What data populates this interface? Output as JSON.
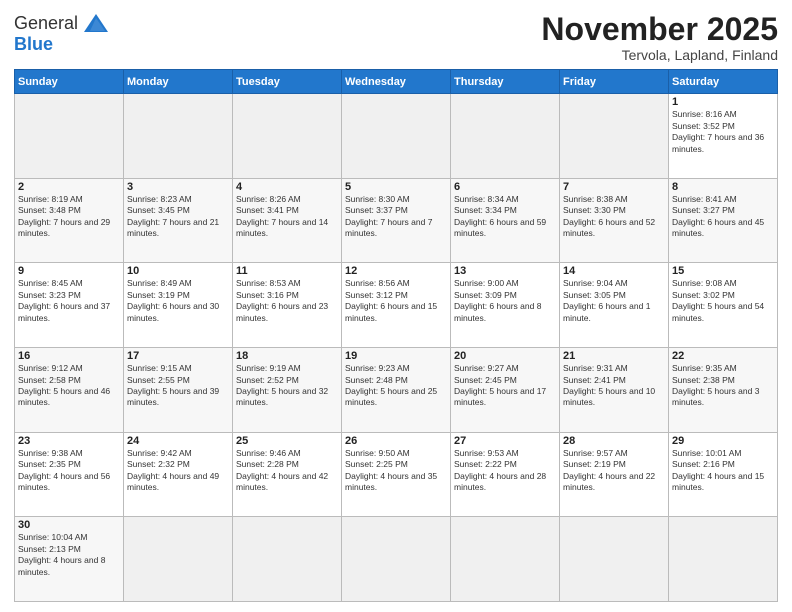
{
  "header": {
    "logo": {
      "general": "General",
      "blue": "Blue"
    },
    "title": "November 2025",
    "subtitle": "Tervola, Lapland, Finland"
  },
  "weekdays": [
    "Sunday",
    "Monday",
    "Tuesday",
    "Wednesday",
    "Thursday",
    "Friday",
    "Saturday"
  ],
  "weeks": [
    [
      {
        "day": null,
        "empty": true
      },
      {
        "day": null,
        "empty": true
      },
      {
        "day": null,
        "empty": true
      },
      {
        "day": null,
        "empty": true
      },
      {
        "day": null,
        "empty": true
      },
      {
        "day": null,
        "empty": true
      },
      {
        "day": "1",
        "sunrise": "8:16 AM",
        "sunset": "3:52 PM",
        "daylight": "7 hours and 36 minutes."
      }
    ],
    [
      {
        "day": "2",
        "sunrise": "8:19 AM",
        "sunset": "3:48 PM",
        "daylight": "7 hours and 29 minutes."
      },
      {
        "day": "3",
        "sunrise": "8:23 AM",
        "sunset": "3:45 PM",
        "daylight": "7 hours and 21 minutes."
      },
      {
        "day": "4",
        "sunrise": "8:26 AM",
        "sunset": "3:41 PM",
        "daylight": "7 hours and 14 minutes."
      },
      {
        "day": "5",
        "sunrise": "8:30 AM",
        "sunset": "3:37 PM",
        "daylight": "7 hours and 7 minutes."
      },
      {
        "day": "6",
        "sunrise": "8:34 AM",
        "sunset": "3:34 PM",
        "daylight": "6 hours and 59 minutes."
      },
      {
        "day": "7",
        "sunrise": "8:38 AM",
        "sunset": "3:30 PM",
        "daylight": "6 hours and 52 minutes."
      },
      {
        "day": "8",
        "sunrise": "8:41 AM",
        "sunset": "3:27 PM",
        "daylight": "6 hours and 45 minutes."
      }
    ],
    [
      {
        "day": "9",
        "sunrise": "8:45 AM",
        "sunset": "3:23 PM",
        "daylight": "6 hours and 37 minutes."
      },
      {
        "day": "10",
        "sunrise": "8:49 AM",
        "sunset": "3:19 PM",
        "daylight": "6 hours and 30 minutes."
      },
      {
        "day": "11",
        "sunrise": "8:53 AM",
        "sunset": "3:16 PM",
        "daylight": "6 hours and 23 minutes."
      },
      {
        "day": "12",
        "sunrise": "8:56 AM",
        "sunset": "3:12 PM",
        "daylight": "6 hours and 15 minutes."
      },
      {
        "day": "13",
        "sunrise": "9:00 AM",
        "sunset": "3:09 PM",
        "daylight": "6 hours and 8 minutes."
      },
      {
        "day": "14",
        "sunrise": "9:04 AM",
        "sunset": "3:05 PM",
        "daylight": "6 hours and 1 minute."
      },
      {
        "day": "15",
        "sunrise": "9:08 AM",
        "sunset": "3:02 PM",
        "daylight": "5 hours and 54 minutes."
      }
    ],
    [
      {
        "day": "16",
        "sunrise": "9:12 AM",
        "sunset": "2:58 PM",
        "daylight": "5 hours and 46 minutes."
      },
      {
        "day": "17",
        "sunrise": "9:15 AM",
        "sunset": "2:55 PM",
        "daylight": "5 hours and 39 minutes."
      },
      {
        "day": "18",
        "sunrise": "9:19 AM",
        "sunset": "2:52 PM",
        "daylight": "5 hours and 32 minutes."
      },
      {
        "day": "19",
        "sunrise": "9:23 AM",
        "sunset": "2:48 PM",
        "daylight": "5 hours and 25 minutes."
      },
      {
        "day": "20",
        "sunrise": "9:27 AM",
        "sunset": "2:45 PM",
        "daylight": "5 hours and 17 minutes."
      },
      {
        "day": "21",
        "sunrise": "9:31 AM",
        "sunset": "2:41 PM",
        "daylight": "5 hours and 10 minutes."
      },
      {
        "day": "22",
        "sunrise": "9:35 AM",
        "sunset": "2:38 PM",
        "daylight": "5 hours and 3 minutes."
      }
    ],
    [
      {
        "day": "23",
        "sunrise": "9:38 AM",
        "sunset": "2:35 PM",
        "daylight": "4 hours and 56 minutes."
      },
      {
        "day": "24",
        "sunrise": "9:42 AM",
        "sunset": "2:32 PM",
        "daylight": "4 hours and 49 minutes."
      },
      {
        "day": "25",
        "sunrise": "9:46 AM",
        "sunset": "2:28 PM",
        "daylight": "4 hours and 42 minutes."
      },
      {
        "day": "26",
        "sunrise": "9:50 AM",
        "sunset": "2:25 PM",
        "daylight": "4 hours and 35 minutes."
      },
      {
        "day": "27",
        "sunrise": "9:53 AM",
        "sunset": "2:22 PM",
        "daylight": "4 hours and 28 minutes."
      },
      {
        "day": "28",
        "sunrise": "9:57 AM",
        "sunset": "2:19 PM",
        "daylight": "4 hours and 22 minutes."
      },
      {
        "day": "29",
        "sunrise": "10:01 AM",
        "sunset": "2:16 PM",
        "daylight": "4 hours and 15 minutes."
      }
    ],
    [
      {
        "day": "30",
        "sunrise": "10:04 AM",
        "sunset": "2:13 PM",
        "daylight": "4 hours and 8 minutes."
      },
      {
        "day": null,
        "empty": true
      },
      {
        "day": null,
        "empty": true
      },
      {
        "day": null,
        "empty": true
      },
      {
        "day": null,
        "empty": true
      },
      {
        "day": null,
        "empty": true
      },
      {
        "day": null,
        "empty": true
      }
    ]
  ]
}
